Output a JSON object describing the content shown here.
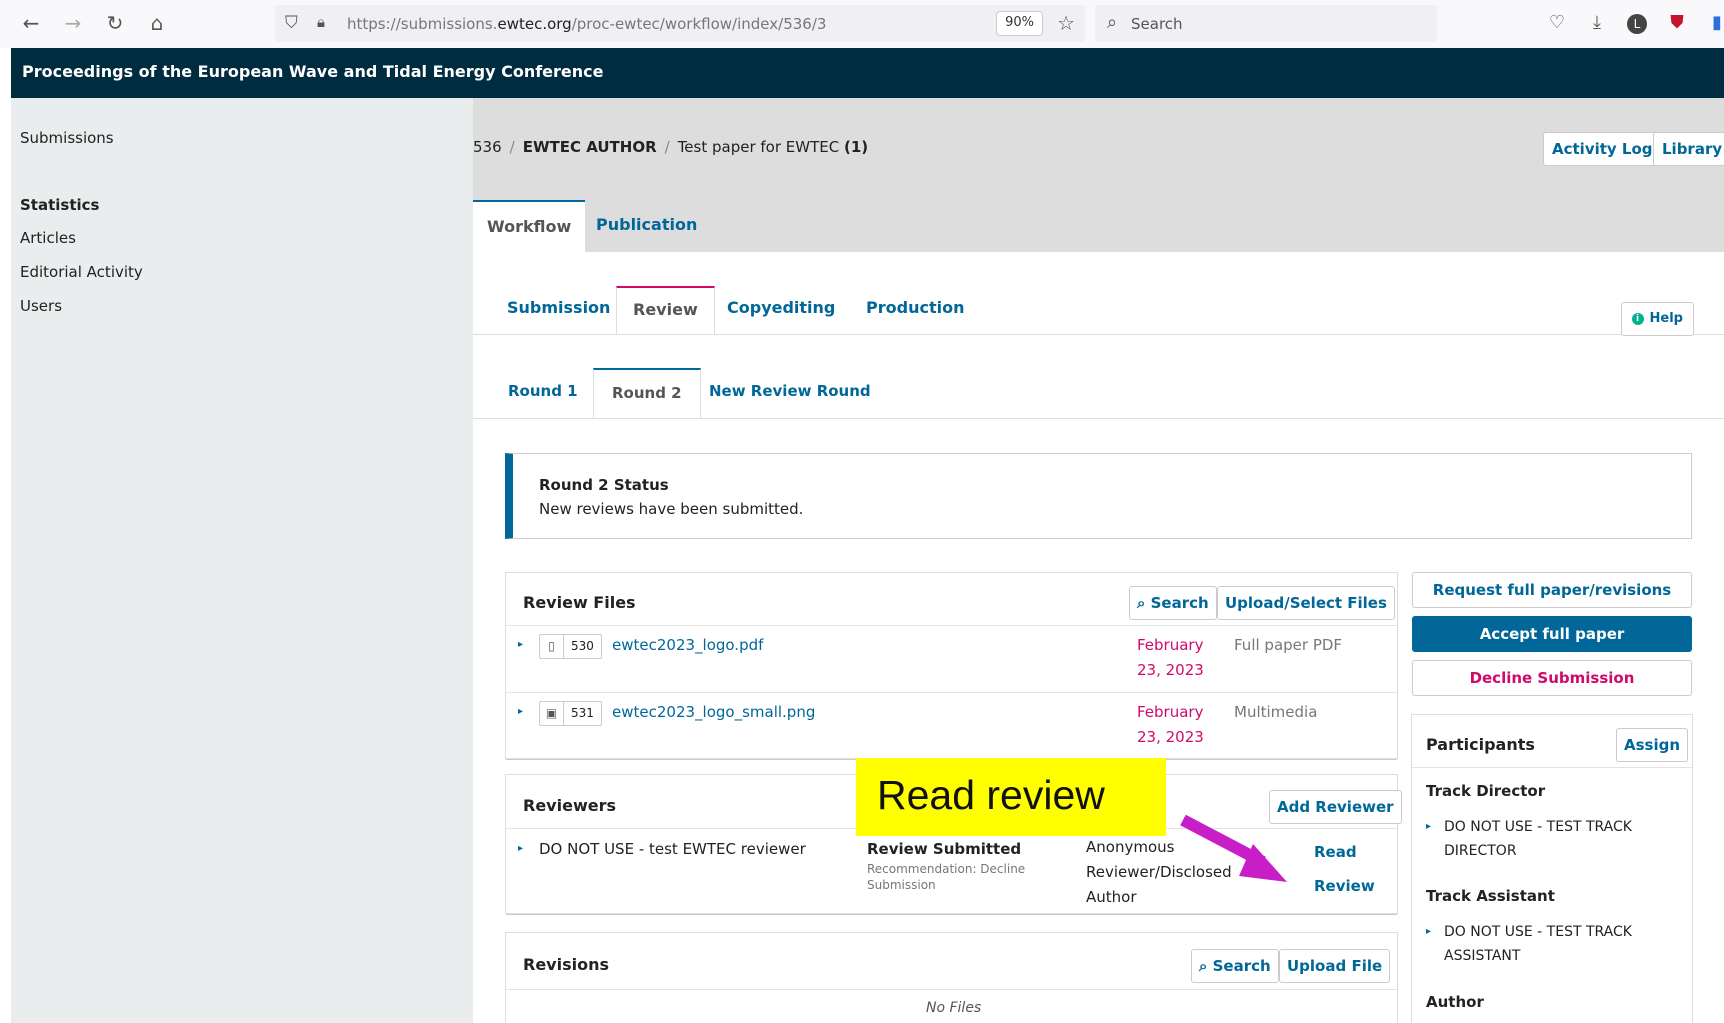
{
  "browser": {
    "url_prefix": "https://submissions.",
    "url_domain": "ewtec.org",
    "url_path": "/proc-ewtec/workflow/index/536/3",
    "zoom": "90%",
    "search_placeholder": "Search"
  },
  "site": {
    "title": "Proceedings of the European Wave and Tidal Energy Conference"
  },
  "sidebar": {
    "submissions": "Submissions",
    "statistics_heading": "Statistics",
    "items": [
      "Articles",
      "Editorial Activity",
      "Users"
    ]
  },
  "breadcrumb": {
    "id": "536",
    "author": "EWTEC AUTHOR",
    "title": "Test paper for EWTEC",
    "count": "(1)"
  },
  "header_buttons": {
    "activity_log": "Activity Log",
    "library": "Library"
  },
  "main_tabs": [
    "Workflow",
    "Publication"
  ],
  "stage_tabs": [
    "Submission",
    "Review",
    "Copyediting",
    "Production"
  ],
  "help_label": "Help",
  "round_tabs": [
    "Round 1",
    "Round 2",
    "New Review Round"
  ],
  "round_status": {
    "title": "Round 2 Status",
    "text": "New reviews have been submitted."
  },
  "review_files": {
    "title": "Review Files",
    "search_label": "Search",
    "upload_label": "Upload/Select Files",
    "files": [
      {
        "id": "530",
        "name": "ewtec2023_logo.pdf",
        "date_line1": "February",
        "date_line2": "23, 2023",
        "type": "Full paper PDF"
      },
      {
        "id": "531",
        "name": "ewtec2023_logo_small.png",
        "date_line1": "February",
        "date_line2": "23, 2023",
        "type": "Multimedia"
      }
    ]
  },
  "reviewers": {
    "title": "Reviewers",
    "add_label": "Add Reviewer",
    "rows": [
      {
        "name": "DO NOT USE - test EWTEC reviewer",
        "status": "Review Submitted",
        "recommendation": "Recommendation: Decline Submission",
        "type": "Anonymous Reviewer/Disclosed Author",
        "action_line1": "Read",
        "action_line2": "Review"
      }
    ]
  },
  "revisions": {
    "title": "Revisions",
    "search_label": "Search",
    "upload_label": "Upload File",
    "empty": "No Files"
  },
  "decisions": {
    "request": "Request full paper/revisions",
    "accept": "Accept full paper",
    "decline": "Decline Submission"
  },
  "participants": {
    "title": "Participants",
    "assign_label": "Assign",
    "groups": [
      {
        "role": "Track Director",
        "member": "DO NOT USE - TEST TRACK DIRECTOR"
      },
      {
        "role": "Track Assistant",
        "member": "DO NOT USE - TEST TRACK ASSISTANT"
      },
      {
        "role": "Author"
      }
    ]
  },
  "annotation": {
    "text": "Read review",
    "color": "#ffff00",
    "arrow_color": "#c81ec8"
  },
  "colors": {
    "header": "#002c40",
    "link": "#006798",
    "accent_pink": "#d00a6c"
  }
}
